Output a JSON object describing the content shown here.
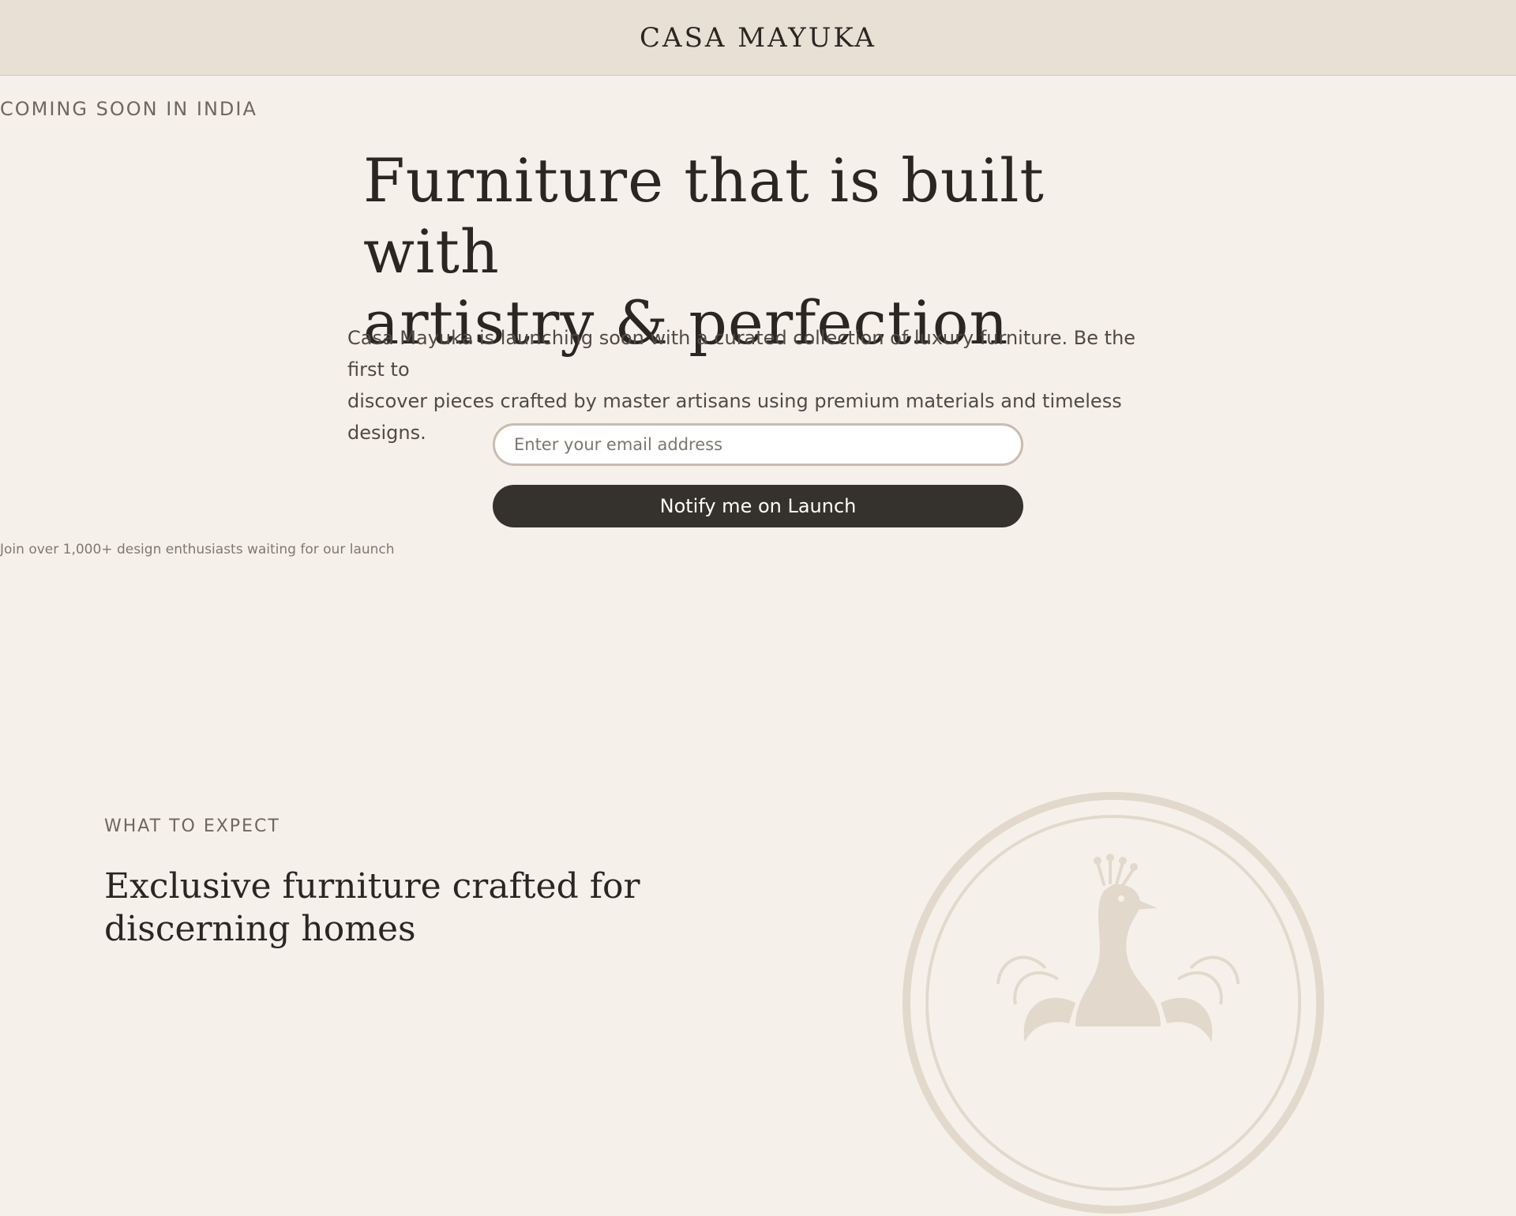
{
  "header": {
    "brand": "CASA MAYUKA"
  },
  "hero": {
    "eyebrow": "COMING SOON IN INDIA",
    "headline_line1": "Furniture that is built with",
    "headline_line2": "artistry & perfection",
    "lede_line1": "Casa Mayuka is launching soon with a curated collection of luxury furniture. Be the first to",
    "lede_line2": "discover pieces crafted by master artisans using premium materials and timeless designs.",
    "email_placeholder": "Enter your email address",
    "email_value": "",
    "notify_label": "Notify me on Launch",
    "note": "Join over 1,000+ design enthusiasts waiting for our launch"
  },
  "expect": {
    "eyebrow": "WHAT TO EXPECT",
    "title_line1": "Exclusive furniture crafted for",
    "title_line2": "discerning homes"
  },
  "emblem": {
    "icon": "peacock-emblem-icon",
    "color": "#e2d8cc"
  },
  "colors": {
    "background": "#f5f1ea",
    "header_background": "#e8dfd5",
    "button": "#35312c",
    "text": "#2a2622"
  }
}
